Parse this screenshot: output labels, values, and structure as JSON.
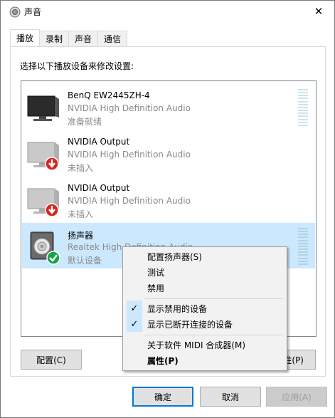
{
  "window": {
    "title": "声音",
    "close_glyph": "✕"
  },
  "tabs": [
    {
      "label": "播放",
      "active": true
    },
    {
      "label": "录制",
      "active": false
    },
    {
      "label": "声音",
      "active": false
    },
    {
      "label": "通信",
      "active": false
    }
  ],
  "instruction": "选择以下播放设备来修改设置:",
  "devices": [
    {
      "name": "BenQ EW2445ZH-4",
      "driver": "NVIDIA High Definition Audio",
      "status": "准备就绪",
      "icon": "monitor-icon",
      "badge": null,
      "selected": false
    },
    {
      "name": "NVIDIA Output",
      "driver": "NVIDIA High Definition Audio",
      "status": "未插入",
      "icon": "monitor-icon",
      "badge": "unplugged-arrow-icon",
      "selected": false
    },
    {
      "name": "NVIDIA Output",
      "driver": "NVIDIA High Definition Audio",
      "status": "未插入",
      "icon": "monitor-icon",
      "badge": "unplugged-arrow-icon",
      "selected": false
    },
    {
      "name": "扬声器",
      "driver": "Realtek High Definition Audio",
      "status": "默认设备",
      "icon": "speaker-icon",
      "badge": "default-check-icon",
      "selected": true
    }
  ],
  "buttons": {
    "configure": "配置(C)",
    "properties_partial": "性(P)",
    "ok": "确定",
    "cancel": "取消",
    "apply": "应用(A)"
  },
  "context_menu": {
    "items": [
      {
        "label": "配置扬声器(S)",
        "checked": false,
        "bold": false
      },
      {
        "label": "测试",
        "checked": false,
        "bold": false
      },
      {
        "label": "禁用",
        "checked": false,
        "bold": false
      },
      {
        "label": "显示禁用的设备",
        "checked": true,
        "bold": false
      },
      {
        "label": "显示已断开连接的设备",
        "checked": true,
        "bold": false
      },
      {
        "label": "关于软件 MIDI 合成器(M)",
        "checked": false,
        "bold": false
      },
      {
        "label": "属性(P)",
        "checked": false,
        "bold": true
      }
    ],
    "check_glyph": "✓"
  },
  "colors": {
    "selection": "#cce8ff",
    "primary_border": "#0078d7",
    "badge_red": "#d9251d",
    "badge_green": "#16a34a"
  }
}
